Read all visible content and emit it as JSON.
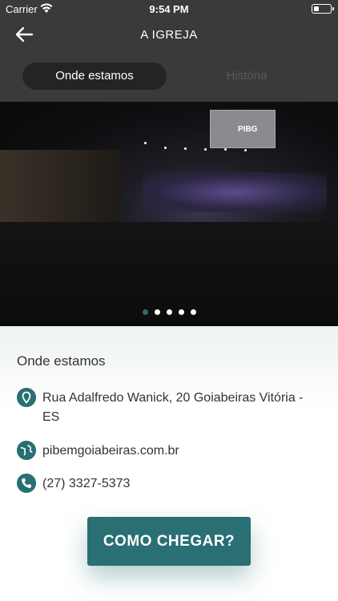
{
  "status_bar": {
    "carrier": "Carrier",
    "time": "9:54 PM"
  },
  "header": {
    "title": "A IGREJA"
  },
  "tabs": [
    {
      "label": "Onde estamos",
      "active": true
    },
    {
      "label": "História",
      "active": false
    }
  ],
  "gallery": {
    "screen_logo": "PIBG",
    "slide_count": 5,
    "active_index": 0
  },
  "info": {
    "section_title": "Onde estamos",
    "address": "Rua Adalfredo Wanick, 20 Goiabeiras Vitória - ES",
    "website": "pibemgoiabeiras.com.br",
    "phone": "(27) 3327-5373"
  },
  "cta_label": "COMO CHEGAR?",
  "colors": {
    "accent": "#2a6f74",
    "header_bg": "#3a3a3a",
    "tab_active_bg": "#242424"
  }
}
